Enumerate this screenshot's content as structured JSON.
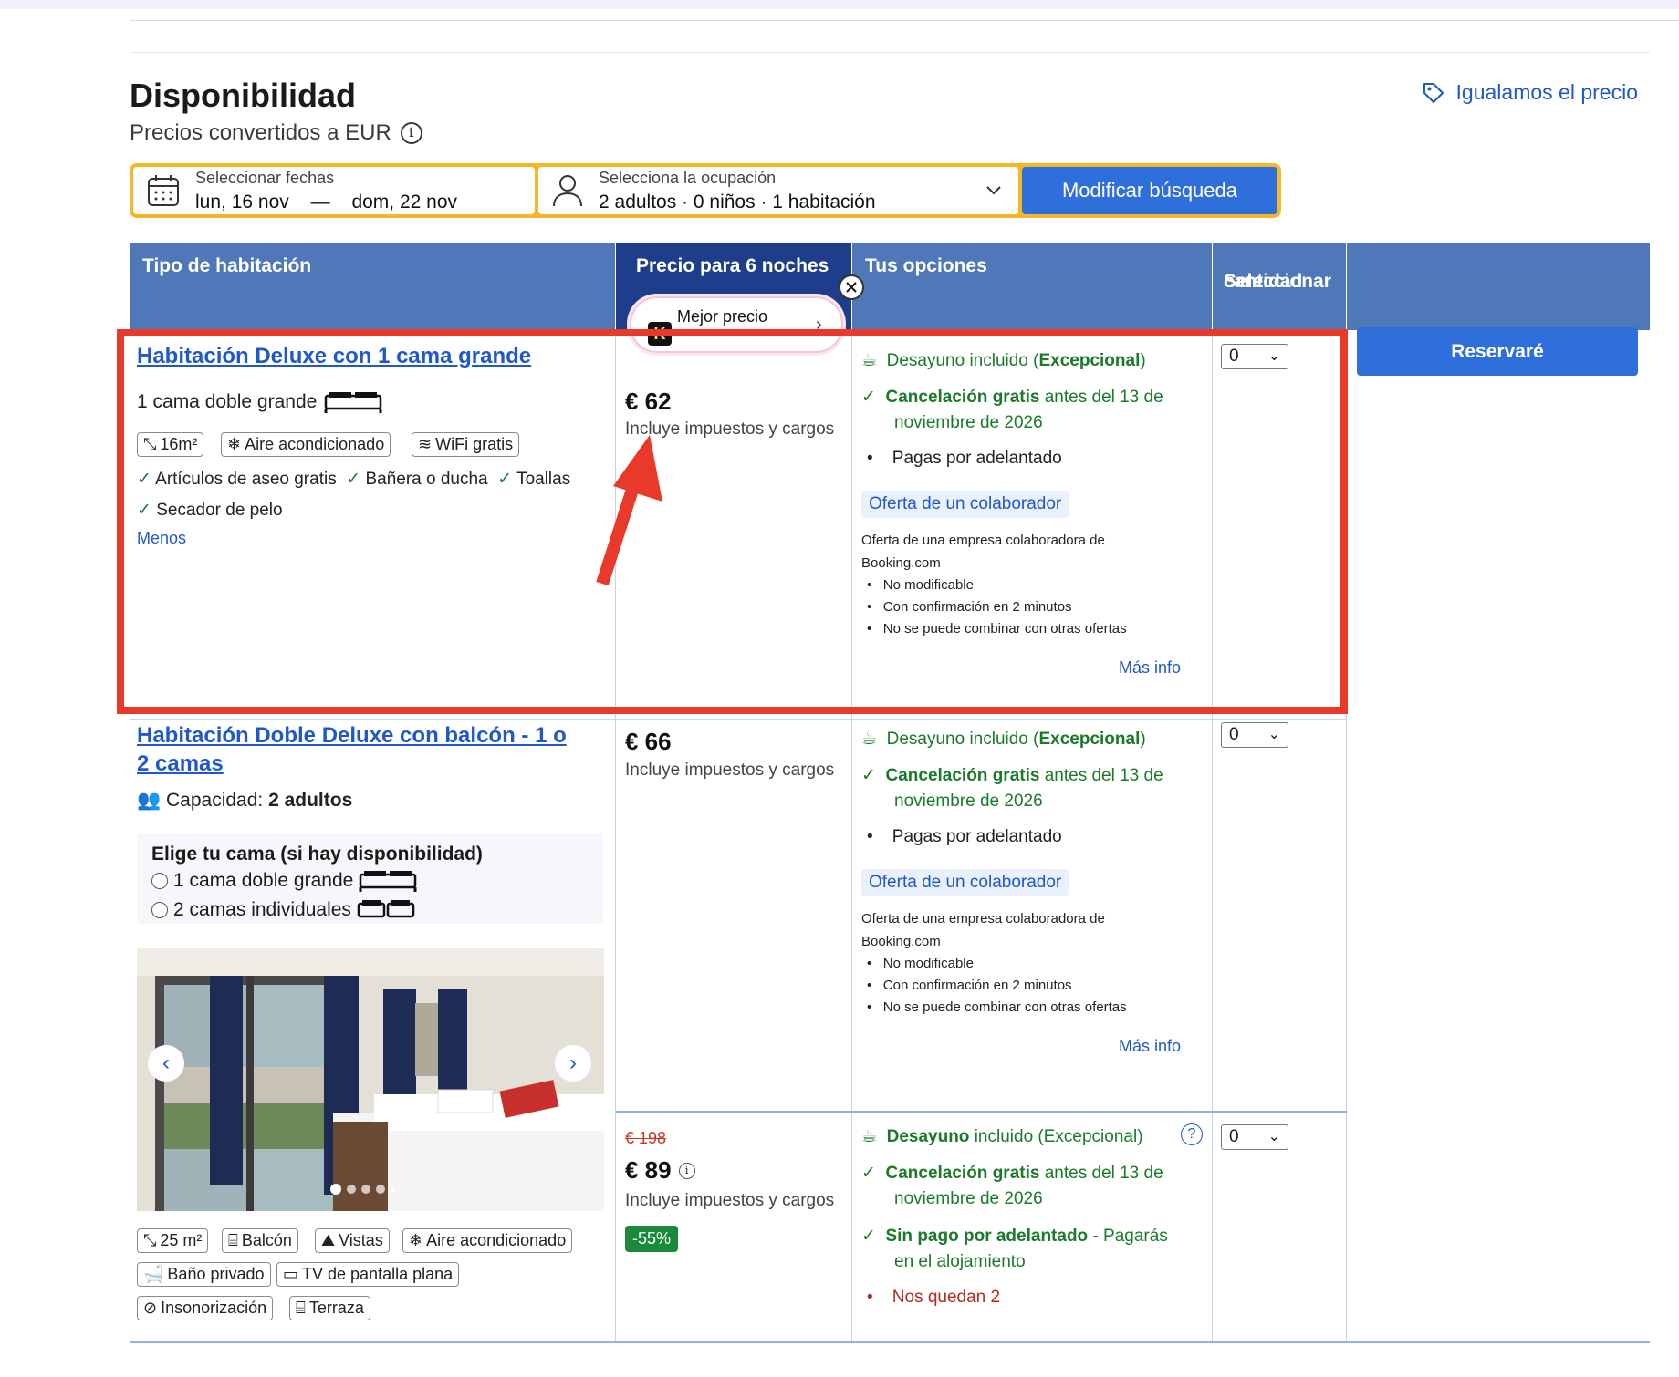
{
  "header": {
    "title": "Disponibilidad",
    "subtitle": "Precios convertidos a EUR",
    "price_match": "Igualamos el precio"
  },
  "search": {
    "dates_label": "Seleccionar fechas",
    "checkin": "lun, 16 nov",
    "dash": "—",
    "checkout": "dom, 22 nov",
    "occupancy_label": "Selecciona la ocupación",
    "occupancy_value": "2 adultos · 0 niños · 1 habitación",
    "button": "Modificar búsqueda"
  },
  "table": {
    "col_room": "Tipo de habitación",
    "col_price": "Precio para 6 noches",
    "col_options": "Tus opciones",
    "col_qty_1": "Seleccionar",
    "col_qty_2": "cantidad",
    "best_price": "Mejor precio"
  },
  "reserve_button": "Reservaré",
  "rooms": [
    {
      "name": "Habitación Deluxe con 1 cama grande",
      "bed": "1 cama doble grande",
      "tags": [
        "16m²",
        "Aire acondicionado",
        "WiFi gratis"
      ],
      "amenities": [
        "Artículos de aseo gratis",
        "Bañera o ducha",
        "Toallas",
        "Secador de pelo"
      ],
      "less": "Menos",
      "price": "€ 62",
      "taxes": "Incluye impuestos y cargos",
      "breakfast_pre": "Desayuno incluido (",
      "breakfast_bold": "Excepcional",
      "breakfast_post": ")",
      "cancel_bold": "Cancelación gratis",
      "cancel_rest": " antes del 13 de",
      "cancel_line2": "noviembre de 2026",
      "prepay": "Pagas por adelantado",
      "partner": "Oferta de un colaborador",
      "partner_desc_1": "Oferta de una empresa colaboradora de",
      "partner_desc_2": "Booking.com",
      "bullets": [
        "No modificable",
        "Con confirmación en 2 minutos",
        "No se puede combinar con otras ofertas"
      ],
      "more_info": "Más info",
      "qty": "0"
    },
    {
      "name_1": "Habitación Doble Deluxe con balcón - 1 o",
      "name_2": "2 camas",
      "capacity_label": "Capacidad: ",
      "capacity_value": "2 adultos",
      "bed_choice_title": "Elige tu cama (si hay disponibilidad)",
      "bed_opt_1": "1 cama doble grande",
      "bed_opt_2": "2 camas individuales",
      "tags": [
        "25 m²",
        "Balcón",
        "Vistas",
        "Aire acondicionado",
        "Baño privado",
        "TV de pantalla plana",
        "Insonorización",
        "Terraza"
      ],
      "price": "€ 66",
      "taxes": "Incluye impuestos y cargos",
      "breakfast_pre": "Desayuno incluido (",
      "breakfast_bold": "Excepcional",
      "breakfast_post": ")",
      "cancel_bold": "Cancelación gratis",
      "cancel_rest": " antes del 13 de",
      "cancel_line2": "noviembre de 2026",
      "prepay": "Pagas por adelantado",
      "partner": "Oferta de un colaborador",
      "partner_desc_1": "Oferta de una empresa colaboradora de",
      "partner_desc_2": "Booking.com",
      "bullets": [
        "No modificable",
        "Con confirmación en 2 minutos",
        "No se puede combinar con otras ofertas"
      ],
      "more_info": "Más info",
      "qty": "0"
    },
    {
      "old_price": "€ 198",
      "price": "€ 89",
      "taxes": "Incluye impuestos y cargos",
      "discount": "-55%",
      "breakfast_bold": "Desayuno",
      "breakfast_rest": " incluido (Excepcional)",
      "cancel_bold": "Cancelación gratis",
      "cancel_rest": " antes del 13 de",
      "cancel_line2": "noviembre de 2026",
      "nopay_bold": "Sin pago por adelantado",
      "nopay_rest": " - Pagarás",
      "nopay_line2": "en el alojamiento",
      "left": "Nos quedan 2",
      "qty": "0"
    }
  ],
  "colors": {
    "accent": "#2f6fdc",
    "header": "#4f78b8",
    "highlight": "#e8392a",
    "green": "#1a7a2a",
    "search_border": "#f5b72a"
  }
}
